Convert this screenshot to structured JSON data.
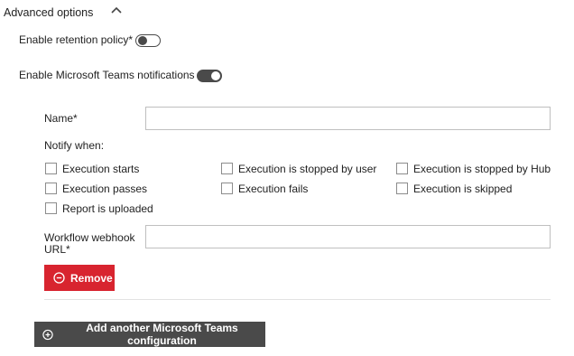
{
  "section": {
    "title": "Advanced options",
    "chevron_icon": "chevron-up-icon"
  },
  "retention": {
    "label": "Enable retention policy*",
    "enabled": false
  },
  "teams": {
    "label": "Enable Microsoft Teams notifications",
    "enabled": true
  },
  "config": {
    "name_label": "Name*",
    "name_value": "",
    "notify_label": "Notify when:",
    "events": [
      {
        "label": "Execution starts",
        "checked": false
      },
      {
        "label": "Execution is stopped by user",
        "checked": false
      },
      {
        "label": "Execution is stopped by Hub",
        "checked": false
      },
      {
        "label": "Execution passes",
        "checked": false
      },
      {
        "label": "Execution fails",
        "checked": false
      },
      {
        "label": "Execution is skipped",
        "checked": false
      },
      {
        "label": "Report is uploaded",
        "checked": false
      }
    ],
    "webhook_label_line1": "Workflow webhook",
    "webhook_label_line2": "URL*",
    "webhook_value": "",
    "remove_label": "Remove",
    "remove_icon": "minus-circle-icon"
  },
  "add_button": {
    "label": "Add another Microsoft Teams configuration",
    "icon": "plus-circle-icon"
  },
  "colors": {
    "remove_bg": "#d8242f",
    "add_bg": "#4a4a4a",
    "toggle": "#4a4a4a"
  }
}
